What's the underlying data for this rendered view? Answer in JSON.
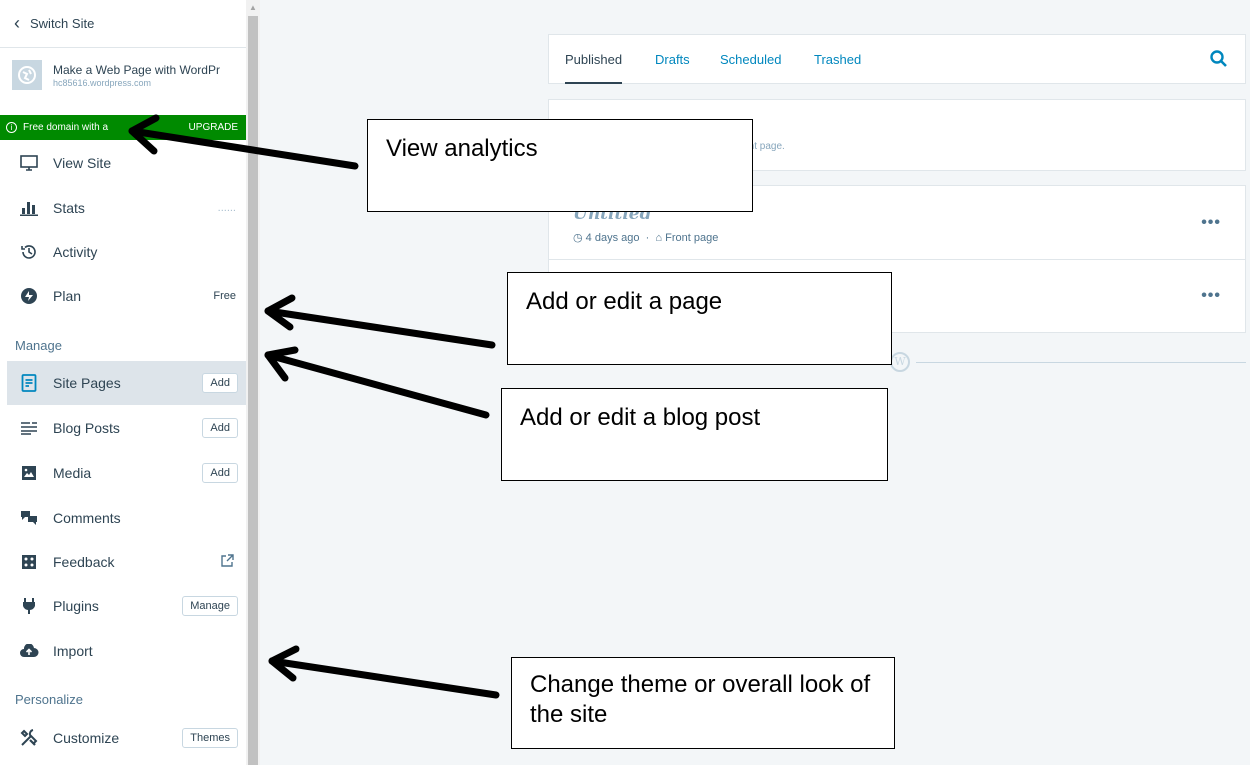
{
  "sidebar": {
    "switch_site": "Switch Site",
    "site": {
      "title": "Make a Web Page with WordPr",
      "url": "hc85616.wordpress.com"
    },
    "banner": {
      "text": "Free domain with a",
      "action": "UPGRADE"
    },
    "top_items": [
      {
        "label": "View Site",
        "icon": "monitor-icon"
      },
      {
        "label": "Stats",
        "icon": "stats-icon",
        "right": "......"
      },
      {
        "label": "Activity",
        "icon": "history-icon"
      },
      {
        "label": "Plan",
        "icon": "plan-icon",
        "right": "Free"
      }
    ],
    "manage_label": "Manage",
    "manage_items": [
      {
        "label": "Site Pages",
        "icon": "pages-icon",
        "button": "Add"
      },
      {
        "label": "Blog Posts",
        "icon": "posts-icon",
        "button": "Add"
      },
      {
        "label": "Media",
        "icon": "media-icon",
        "button": "Add"
      },
      {
        "label": "Comments",
        "icon": "comments-icon"
      },
      {
        "label": "Feedback",
        "icon": "feedback-icon",
        "right_icon": "external-link-icon"
      },
      {
        "label": "Plugins",
        "icon": "plugins-icon",
        "button": "Manage"
      },
      {
        "label": "Import",
        "icon": "import-icon"
      }
    ],
    "personalize_label": "Personalize",
    "personalize_items": [
      {
        "label": "Customize",
        "icon": "customize-icon",
        "button": "Themes"
      }
    ]
  },
  "main": {
    "tabs": [
      "Published",
      "Drafts",
      "Scheduled",
      "Trashed"
    ],
    "active_tab": "Published",
    "card1_text": "front page.",
    "pages": [
      {
        "title": "Untitled",
        "age": "4 days ago",
        "badge": "Front page"
      }
    ]
  },
  "annotations": [
    "View analytics",
    "Add or edit a page",
    "Add or edit a blog post",
    "Change theme or overall look of the site"
  ],
  "colors": {
    "accent": "#0087be",
    "banner": "#008a00",
    "text": "#2e4453",
    "selected_bg": "#dde4ea",
    "main_bg": "#f3f6f8"
  }
}
